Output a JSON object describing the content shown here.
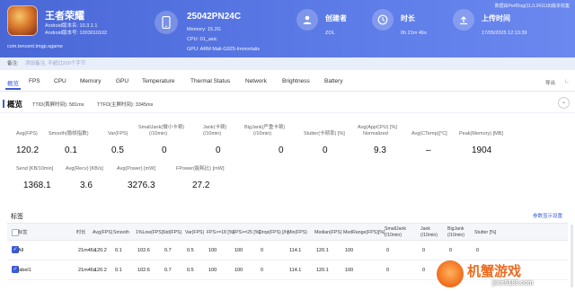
{
  "app": {
    "name": "王者荣耀",
    "android_version_label": "Android版本名: 10.3.1.1",
    "android_version_code": "Android版本号: 1003010102",
    "package": "com.tencent.tmgp.sgame"
  },
  "device": {
    "name": "25042PN24C",
    "memory": "Memory: 15.2G",
    "cpu": "CPU: 01_asic",
    "gpu": "GPU: ARM Mali-G925-Immortalis"
  },
  "stats": [
    {
      "label": "创建者",
      "value": "ZOL",
      "icon": "user-icon"
    },
    {
      "label": "时长",
      "value": "0h 21m 46s",
      "icon": "clock-icon"
    },
    {
      "label": "上传时间",
      "value": "17/05/2025 12:13:39",
      "icon": "upload-icon"
    }
  ],
  "export_link": "数据由PerfDog(11.0.241118)版本收集",
  "note": {
    "label": "备注:",
    "placeholder": "添加备注, 不超过200个字节"
  },
  "tabs": [
    "概览",
    "FPS",
    "CPU",
    "Memory",
    "GPU",
    "Temperature",
    "Thermal Status",
    "Network",
    "Brightness",
    "Battery"
  ],
  "tab_actions": {
    "export": "导出",
    "collapse": "∟"
  },
  "overview": {
    "title": "概览",
    "ttid": "TTID(首屏时间): 581ms",
    "ttfd": "TTFD(主屏时间): 3345ms",
    "row1": [
      {
        "label": "Avg(FPS)",
        "value": "120.2"
      },
      {
        "label": "Smooth(稳帧指数)",
        "value": "0.1"
      },
      {
        "label": "Var(FPS)",
        "value": "0.5"
      },
      {
        "label": "SmallJank(微小卡顿)",
        "label2": "(/10min)",
        "value": "0"
      },
      {
        "label": "Jank(卡顿)",
        "label2": "(/10min)",
        "value": "0"
      },
      {
        "label": "BigJank(严重卡顿)",
        "label2": "(/10min)",
        "value": "0"
      },
      {
        "label": "Stutter(卡顿率) [%]",
        "value": "0"
      },
      {
        "label": "Avg(AppCPU) [%]",
        "label2": "Normalized",
        "value": "9.3"
      },
      {
        "label": "Avg(CTemp)[°C]",
        "value": "–"
      },
      {
        "label": "Peak(Memory) [MB]",
        "value": "1904"
      }
    ],
    "row2": [
      {
        "label": "Send [KB/10min]",
        "value": "1368.1"
      },
      {
        "label": "Avg(Recv) [KB/s]",
        "value": "3.6"
      },
      {
        "label": "Avg(Power) [mW]",
        "value": "3276.3"
      },
      {
        "label": "FPower(能耗比) [mW]",
        "value": "27.2"
      }
    ]
  },
  "labels_table": {
    "title": "标签",
    "settings_link": "参数显示设置",
    "headers": [
      "标签",
      "时长",
      "Avg(FPS)",
      "Smooth",
      "1%Low(FPS)",
      "Std(FPS)",
      "Var(FPS)",
      "FPS>=18 [%]",
      "FPS>=25 [%]",
      "Drop(FPS) [/h]",
      "Min(FPS)",
      "Median(FPS)",
      "MedRange(FPS)[%]",
      "SmallJank\n(/10min)",
      "Jank\n(/10min)",
      "BigJank\n(/10min)",
      "Stutter [%]"
    ],
    "rows": [
      {
        "checked": true,
        "cells": [
          "All",
          "21m46s",
          "120.2",
          "0.1",
          "102.6",
          "0.7",
          "0.5",
          "100",
          "100",
          "0",
          "114.1",
          "120.1",
          "100",
          "0",
          "0",
          "0",
          "0"
        ]
      },
      {
        "checked": true,
        "cells": [
          "label1",
          "21m46s",
          "120.2",
          "0.1",
          "102.6",
          "0.7",
          "0.5",
          "100",
          "100",
          "0",
          "114.1",
          "120.1",
          "100",
          "0",
          "0",
          "0",
          "0"
        ]
      }
    ]
  },
  "watermark": {
    "title": "机蟹游戏",
    "url": "jixie5188.com"
  },
  "colors": {
    "header": "#5b7ae6",
    "accent": "#3b5bd6",
    "watermark": "#ee6a1d"
  }
}
